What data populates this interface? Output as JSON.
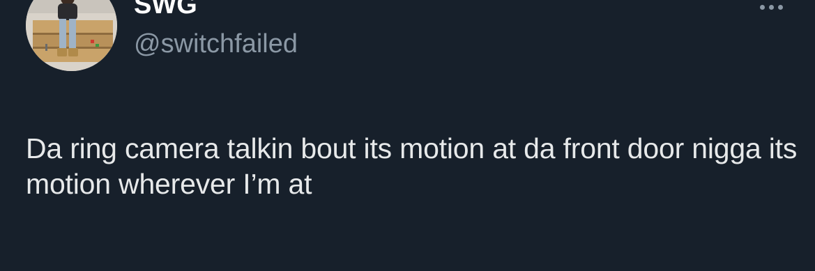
{
  "tweet": {
    "display_name": "SWG",
    "handle": "@switchfailed",
    "text": "Da ring camera talkin bout its motion at da front door nigga its motion wherever I’m at",
    "more_icon": "more-horizontal-icon"
  },
  "colors": {
    "background": "#17202b",
    "text": "#e7e9ea",
    "secondary_text": "#8b98a5"
  }
}
